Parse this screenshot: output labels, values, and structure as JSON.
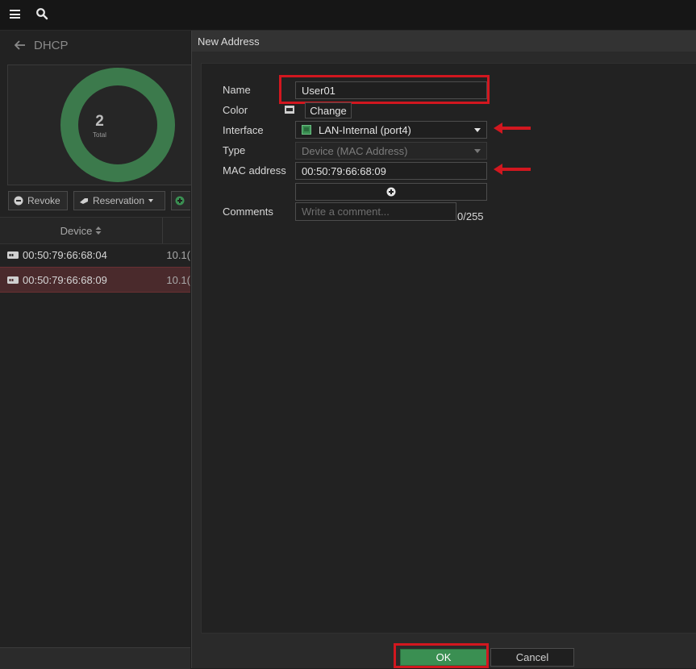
{
  "colors": {
    "accent_green": "#3a8f52",
    "highlight_red": "#d2171f",
    "selected_row": "#4a2a2c"
  },
  "header": {
    "menu_icon": "hamburger-icon",
    "search_icon": "search-icon"
  },
  "left_panel": {
    "title": "DHCP",
    "summary": {
      "total_value": "2",
      "total_label": "Total",
      "fill_fraction": 1.0
    },
    "toolbar": {
      "revoke_label": "Revoke",
      "reservation_label": "Reservation"
    },
    "table": {
      "columns": [
        "Device"
      ],
      "rows": [
        {
          "device": "00:50:79:66:68:04",
          "ip": "10.1("
        },
        {
          "device": "00:50:79:66:68:09",
          "ip": "10.1("
        }
      ]
    }
  },
  "dialog": {
    "title": "New Address",
    "fields": {
      "name_label": "Name",
      "name_value": "User01",
      "color_label": "Color",
      "color_change_label": "Change",
      "interface_label": "Interface",
      "interface_value": "LAN-Internal (port4)",
      "type_label": "Type",
      "type_value": "Device (MAC Address)",
      "mac_label": "MAC address",
      "mac_value": "00:50:79:66:68:09",
      "comments_label": "Comments",
      "comments_placeholder": "Write a comment...",
      "comments_count": "0/255"
    },
    "footer": {
      "ok_label": "OK",
      "cancel_label": "Cancel"
    }
  }
}
